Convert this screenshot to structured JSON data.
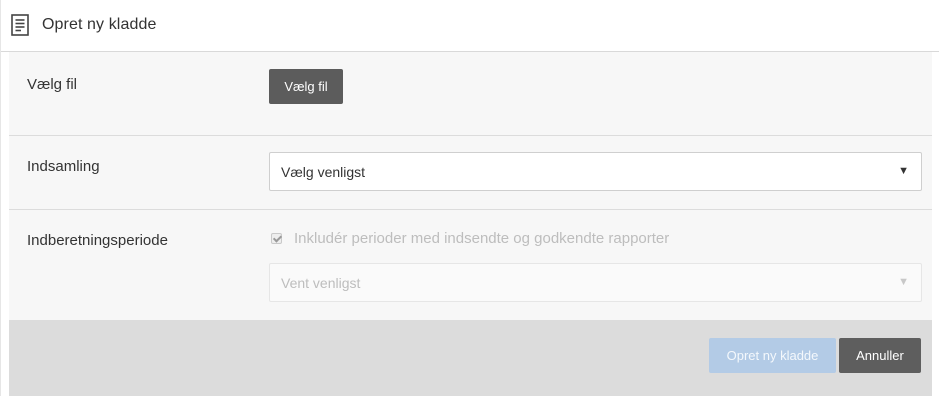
{
  "header": {
    "title": "Opret ny kladde",
    "icon": "document-icon"
  },
  "form": {
    "file": {
      "label": "Vælg fil",
      "button_label": "Vælg fil"
    },
    "collection": {
      "label": "Indsamling",
      "selected_value": "Vælg venligst"
    },
    "period": {
      "label": "Indberetningsperiode",
      "checkbox_label": "Inkludér perioder med indsendte og godkendte rapporter",
      "checkbox_checked": true,
      "checkbox_disabled": true,
      "select_value": "Vent venligst",
      "select_disabled": true
    }
  },
  "footer": {
    "create_label": "Opret ny kladde",
    "cancel_label": "Annuller"
  },
  "colors": {
    "primary_disabled": "#b3cbe6",
    "secondary": "#5e5e5e",
    "body_bg": "#f7f7f7",
    "footer_bg": "#dcdcdc"
  }
}
